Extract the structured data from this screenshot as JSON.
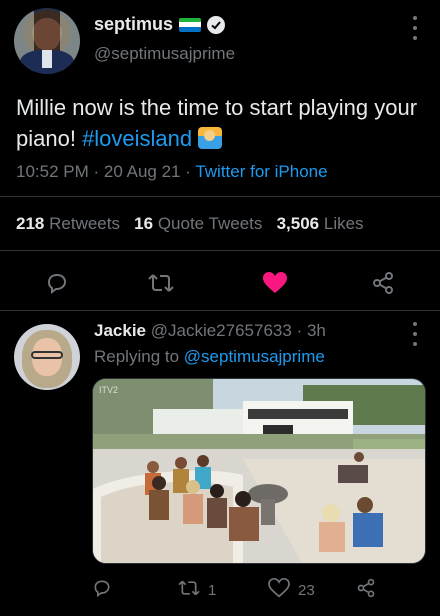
{
  "tweet": {
    "display_name": "septimus",
    "handle": "@septimusajprime",
    "text_before": "Millie now is the time to start playing your piano! ",
    "hashtag": "#loveisland",
    "time": "10:52 PM",
    "date": "20 Aug 21",
    "separator": "·",
    "source": "Twitter for iPhone",
    "flag_colors": [
      "#1eb53a",
      "#ffffff",
      "#0072c6"
    ],
    "stats": {
      "retweets_count": "218",
      "retweets_label": "Retweets",
      "quotes_count": "16",
      "quotes_label": "Quote Tweets",
      "likes_count": "3,506",
      "likes_label": "Likes"
    },
    "liked": true,
    "accent_color": "#1d9bf0",
    "like_color": "#f91880"
  },
  "reply": {
    "display_name": "Jackie",
    "handle": "@Jackie27657633",
    "age": "3h",
    "replying_label": "Replying to",
    "replying_handle": "@septimusajprime",
    "media_watermark": "ITV2",
    "retweet_count": "1",
    "like_count": "23"
  }
}
